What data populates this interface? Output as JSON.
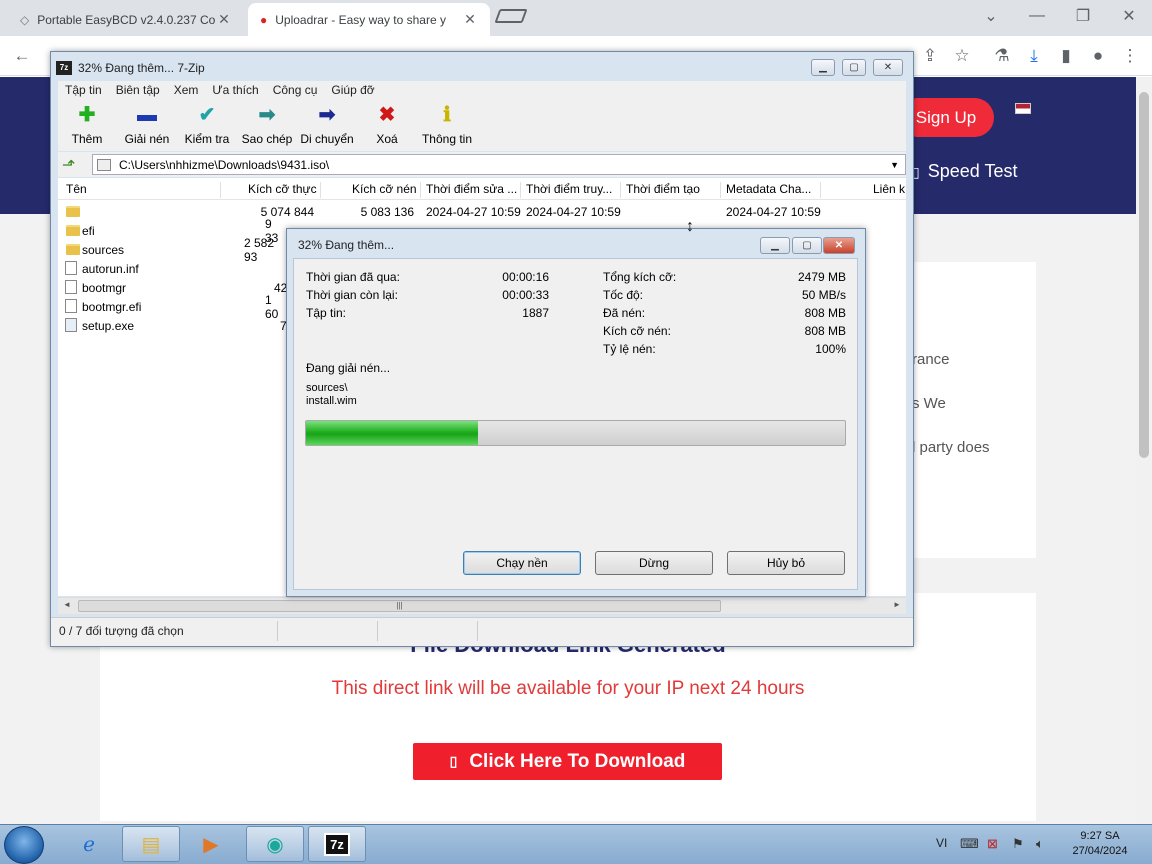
{
  "browser": {
    "tabs": [
      {
        "title": "Portable EasyBCD v2.4.0.237 Co",
        "active": false
      },
      {
        "title": "Uploadrar - Easy way to share y",
        "active": true
      }
    ],
    "toolbar_icons": [
      "back-icon",
      "share-icon",
      "star-icon",
      "extension-icon",
      "download-icon",
      "sidepanel-icon",
      "profile-icon",
      "menu-icon"
    ]
  },
  "site": {
    "signup_label": "Sign Up",
    "speedtest_label": "Speed Test",
    "edge_texts": [
      "rance",
      "s We",
      "l party does"
    ],
    "download_title": "File Download Link Generated",
    "download_subtitle": "This direct link will be available for your IP next 24 hours",
    "download_button": "Click Here To Download",
    "colors": {
      "header": "#252a6b",
      "accent_red": "#ef1f2c"
    }
  },
  "zip": {
    "title": "32% Đang thêm... 7-Zip",
    "menu": [
      "Tập tin",
      "Biên tập",
      "Xem",
      "Ưa thích",
      "Công cụ",
      "Giúp đỡ"
    ],
    "tools": [
      {
        "label": "Thêm",
        "icon": "add-icon"
      },
      {
        "label": "Giải nén",
        "icon": "extract-icon"
      },
      {
        "label": "Kiểm tra",
        "icon": "test-icon"
      },
      {
        "label": "Sao chép",
        "icon": "copy-icon"
      },
      {
        "label": "Di chuyển",
        "icon": "move-icon"
      },
      {
        "label": "Xoá",
        "icon": "delete-icon"
      },
      {
        "label": "Thông tin",
        "icon": "info-icon"
      }
    ],
    "address": "C:\\Users\\nhhizme\\Downloads\\9431.iso\\",
    "columns": [
      "Tên",
      "Kích cỡ thực",
      "Kích cỡ nén",
      "Thời điểm sửa ...",
      "Thời điểm truy...",
      "Thời điểm tạo",
      "Metadata Cha...",
      "Liên k"
    ],
    "rows": [
      {
        "name": "",
        "type": "folder",
        "size": "5 074 844",
        "packed": "5 083 136",
        "modified": "2024-04-27 10:59",
        "accessed": "2024-04-27 10:59",
        "created": "",
        "metadata": "2024-04-27 10:59"
      },
      {
        "name": "efi",
        "type": "folder",
        "size": "9 33",
        "packed": "",
        "modified": "",
        "accessed": "",
        "created": "",
        "metadata": ""
      },
      {
        "name": "sources",
        "type": "folder",
        "size": "2 582 93",
        "packed": "",
        "modified": "",
        "accessed": "",
        "created": "",
        "metadata": ""
      },
      {
        "name": "autorun.inf",
        "type": "file",
        "size": "",
        "packed": "",
        "modified": "",
        "accessed": "",
        "created": "",
        "metadata": ""
      },
      {
        "name": "bootmgr",
        "type": "file",
        "size": "42",
        "packed": "",
        "modified": "",
        "accessed": "",
        "created": "",
        "metadata": ""
      },
      {
        "name": "bootmgr.efi",
        "type": "file",
        "size": "1 60",
        "packed": "",
        "modified": "",
        "accessed": "",
        "created": "",
        "metadata": ""
      },
      {
        "name": "setup.exe",
        "type": "file",
        "size": "7",
        "packed": "",
        "modified": "",
        "accessed": "",
        "created": "",
        "metadata": ""
      }
    ],
    "status": "0 / 7 đối tượng đã chọn"
  },
  "progress": {
    "title": "32% Đang thêm...",
    "left": [
      {
        "label": "Thời gian đã qua:",
        "value": "00:00:16"
      },
      {
        "label": "Thời gian còn lại:",
        "value": "00:00:33"
      },
      {
        "label": "Tập tin:",
        "value": "1887"
      }
    ],
    "right": [
      {
        "label": "Tổng kích cỡ:",
        "value": "2479 MB"
      },
      {
        "label": "Tốc độ:",
        "value": "50 MB/s"
      },
      {
        "label": "Đã nén:",
        "value": "808 MB"
      },
      {
        "label": "Kích cỡ nén:",
        "value": "808 MB"
      },
      {
        "label": "Tỷ lệ nén:",
        "value": "100%"
      }
    ],
    "operation": "Đang giải nén...",
    "current_path": "sources\\",
    "current_file": "install.wim",
    "percent": 32,
    "buttons": [
      "Chạy nền",
      "Dừng",
      "Hủy bỏ"
    ]
  },
  "taskbar": {
    "language": "VI",
    "time": "9:27 SA",
    "date": "27/04/2024",
    "zip_label": "7z"
  }
}
